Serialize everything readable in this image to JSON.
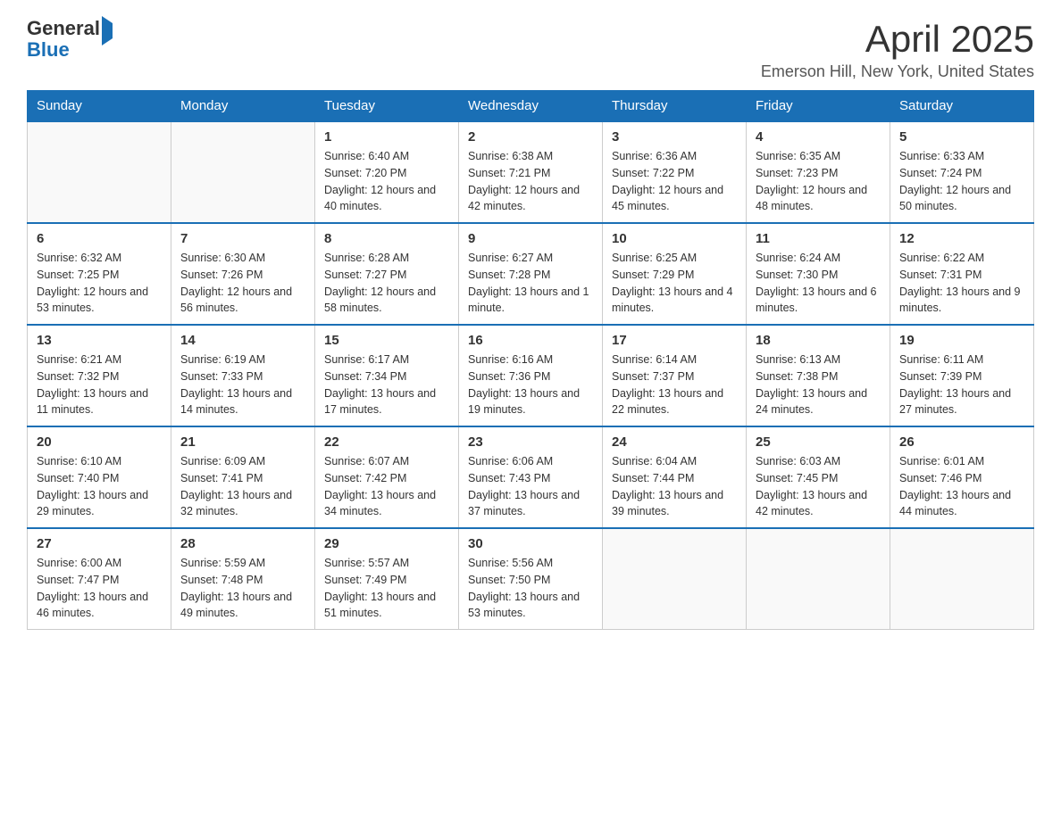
{
  "header": {
    "logo_general": "General",
    "logo_blue": "Blue",
    "month_title": "April 2025",
    "location": "Emerson Hill, New York, United States"
  },
  "days_of_week": [
    "Sunday",
    "Monday",
    "Tuesday",
    "Wednesday",
    "Thursday",
    "Friday",
    "Saturday"
  ],
  "weeks": [
    [
      {
        "day": "",
        "info": ""
      },
      {
        "day": "",
        "info": ""
      },
      {
        "day": "1",
        "info": "Sunrise: 6:40 AM\nSunset: 7:20 PM\nDaylight: 12 hours\nand 40 minutes."
      },
      {
        "day": "2",
        "info": "Sunrise: 6:38 AM\nSunset: 7:21 PM\nDaylight: 12 hours\nand 42 minutes."
      },
      {
        "day": "3",
        "info": "Sunrise: 6:36 AM\nSunset: 7:22 PM\nDaylight: 12 hours\nand 45 minutes."
      },
      {
        "day": "4",
        "info": "Sunrise: 6:35 AM\nSunset: 7:23 PM\nDaylight: 12 hours\nand 48 minutes."
      },
      {
        "day": "5",
        "info": "Sunrise: 6:33 AM\nSunset: 7:24 PM\nDaylight: 12 hours\nand 50 minutes."
      }
    ],
    [
      {
        "day": "6",
        "info": "Sunrise: 6:32 AM\nSunset: 7:25 PM\nDaylight: 12 hours\nand 53 minutes."
      },
      {
        "day": "7",
        "info": "Sunrise: 6:30 AM\nSunset: 7:26 PM\nDaylight: 12 hours\nand 56 minutes."
      },
      {
        "day": "8",
        "info": "Sunrise: 6:28 AM\nSunset: 7:27 PM\nDaylight: 12 hours\nand 58 minutes."
      },
      {
        "day": "9",
        "info": "Sunrise: 6:27 AM\nSunset: 7:28 PM\nDaylight: 13 hours\nand 1 minute."
      },
      {
        "day": "10",
        "info": "Sunrise: 6:25 AM\nSunset: 7:29 PM\nDaylight: 13 hours\nand 4 minutes."
      },
      {
        "day": "11",
        "info": "Sunrise: 6:24 AM\nSunset: 7:30 PM\nDaylight: 13 hours\nand 6 minutes."
      },
      {
        "day": "12",
        "info": "Sunrise: 6:22 AM\nSunset: 7:31 PM\nDaylight: 13 hours\nand 9 minutes."
      }
    ],
    [
      {
        "day": "13",
        "info": "Sunrise: 6:21 AM\nSunset: 7:32 PM\nDaylight: 13 hours\nand 11 minutes."
      },
      {
        "day": "14",
        "info": "Sunrise: 6:19 AM\nSunset: 7:33 PM\nDaylight: 13 hours\nand 14 minutes."
      },
      {
        "day": "15",
        "info": "Sunrise: 6:17 AM\nSunset: 7:34 PM\nDaylight: 13 hours\nand 17 minutes."
      },
      {
        "day": "16",
        "info": "Sunrise: 6:16 AM\nSunset: 7:36 PM\nDaylight: 13 hours\nand 19 minutes."
      },
      {
        "day": "17",
        "info": "Sunrise: 6:14 AM\nSunset: 7:37 PM\nDaylight: 13 hours\nand 22 minutes."
      },
      {
        "day": "18",
        "info": "Sunrise: 6:13 AM\nSunset: 7:38 PM\nDaylight: 13 hours\nand 24 minutes."
      },
      {
        "day": "19",
        "info": "Sunrise: 6:11 AM\nSunset: 7:39 PM\nDaylight: 13 hours\nand 27 minutes."
      }
    ],
    [
      {
        "day": "20",
        "info": "Sunrise: 6:10 AM\nSunset: 7:40 PM\nDaylight: 13 hours\nand 29 minutes."
      },
      {
        "day": "21",
        "info": "Sunrise: 6:09 AM\nSunset: 7:41 PM\nDaylight: 13 hours\nand 32 minutes."
      },
      {
        "day": "22",
        "info": "Sunrise: 6:07 AM\nSunset: 7:42 PM\nDaylight: 13 hours\nand 34 minutes."
      },
      {
        "day": "23",
        "info": "Sunrise: 6:06 AM\nSunset: 7:43 PM\nDaylight: 13 hours\nand 37 minutes."
      },
      {
        "day": "24",
        "info": "Sunrise: 6:04 AM\nSunset: 7:44 PM\nDaylight: 13 hours\nand 39 minutes."
      },
      {
        "day": "25",
        "info": "Sunrise: 6:03 AM\nSunset: 7:45 PM\nDaylight: 13 hours\nand 42 minutes."
      },
      {
        "day": "26",
        "info": "Sunrise: 6:01 AM\nSunset: 7:46 PM\nDaylight: 13 hours\nand 44 minutes."
      }
    ],
    [
      {
        "day": "27",
        "info": "Sunrise: 6:00 AM\nSunset: 7:47 PM\nDaylight: 13 hours\nand 46 minutes."
      },
      {
        "day": "28",
        "info": "Sunrise: 5:59 AM\nSunset: 7:48 PM\nDaylight: 13 hours\nand 49 minutes."
      },
      {
        "day": "29",
        "info": "Sunrise: 5:57 AM\nSunset: 7:49 PM\nDaylight: 13 hours\nand 51 minutes."
      },
      {
        "day": "30",
        "info": "Sunrise: 5:56 AM\nSunset: 7:50 PM\nDaylight: 13 hours\nand 53 minutes."
      },
      {
        "day": "",
        "info": ""
      },
      {
        "day": "",
        "info": ""
      },
      {
        "day": "",
        "info": ""
      }
    ]
  ]
}
